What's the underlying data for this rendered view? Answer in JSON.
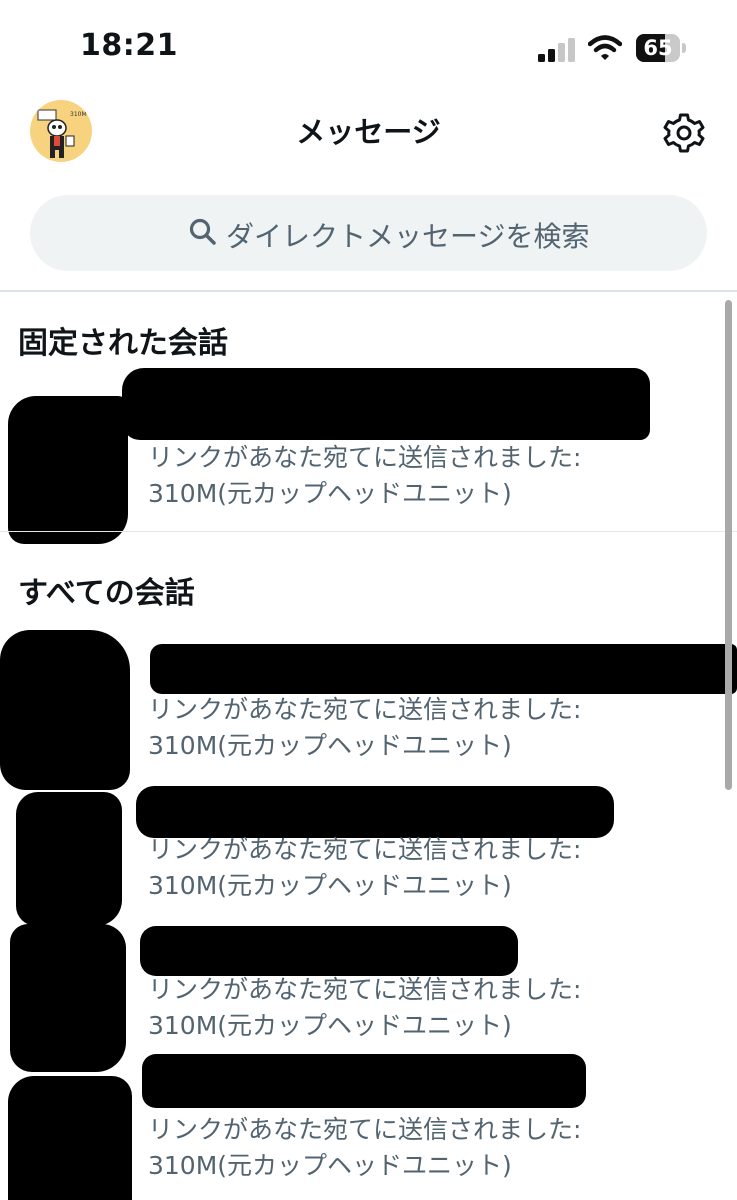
{
  "status_bar": {
    "time": "18:21",
    "battery_level": "65",
    "battery_percent": 65,
    "icons": [
      "cellular-signal-icon",
      "wifi-icon",
      "battery-icon"
    ]
  },
  "header": {
    "title": "メッセージ",
    "avatar_icon": "profile-avatar",
    "settings_icon": "gear-icon"
  },
  "search": {
    "placeholder": "ダイレクトメッセージを検索",
    "icon": "search-icon"
  },
  "sections": {
    "pinned_title": "固定された会話",
    "all_title": "すべての会話"
  },
  "pinned_conversations": [
    {
      "preview_line1": "リンクがあなた宛てに送信されました:",
      "preview_line2": "310M(元カップヘッドユニット)"
    }
  ],
  "conversations": [
    {
      "preview_line1": "リンクがあなた宛てに送信されました:",
      "preview_line2": "310M(元カップヘッドユニット)"
    },
    {
      "preview_line1": "リンクがあなた宛てに送信されました:",
      "preview_line2": "310M(元カップヘッドユニット)"
    },
    {
      "preview_line1": "リンクがあなた宛てに送信されました:",
      "preview_line2": "310M(元カップヘッドユニット)"
    },
    {
      "preview_line1": "リンクがあなた宛てに送信されました:",
      "preview_line2": "310M(元カップヘッドユニット)"
    }
  ],
  "colors": {
    "text_primary": "#0f1419",
    "text_secondary": "#536471",
    "search_bg": "#eff3f4",
    "avatar_bg": "#f7d27f"
  }
}
